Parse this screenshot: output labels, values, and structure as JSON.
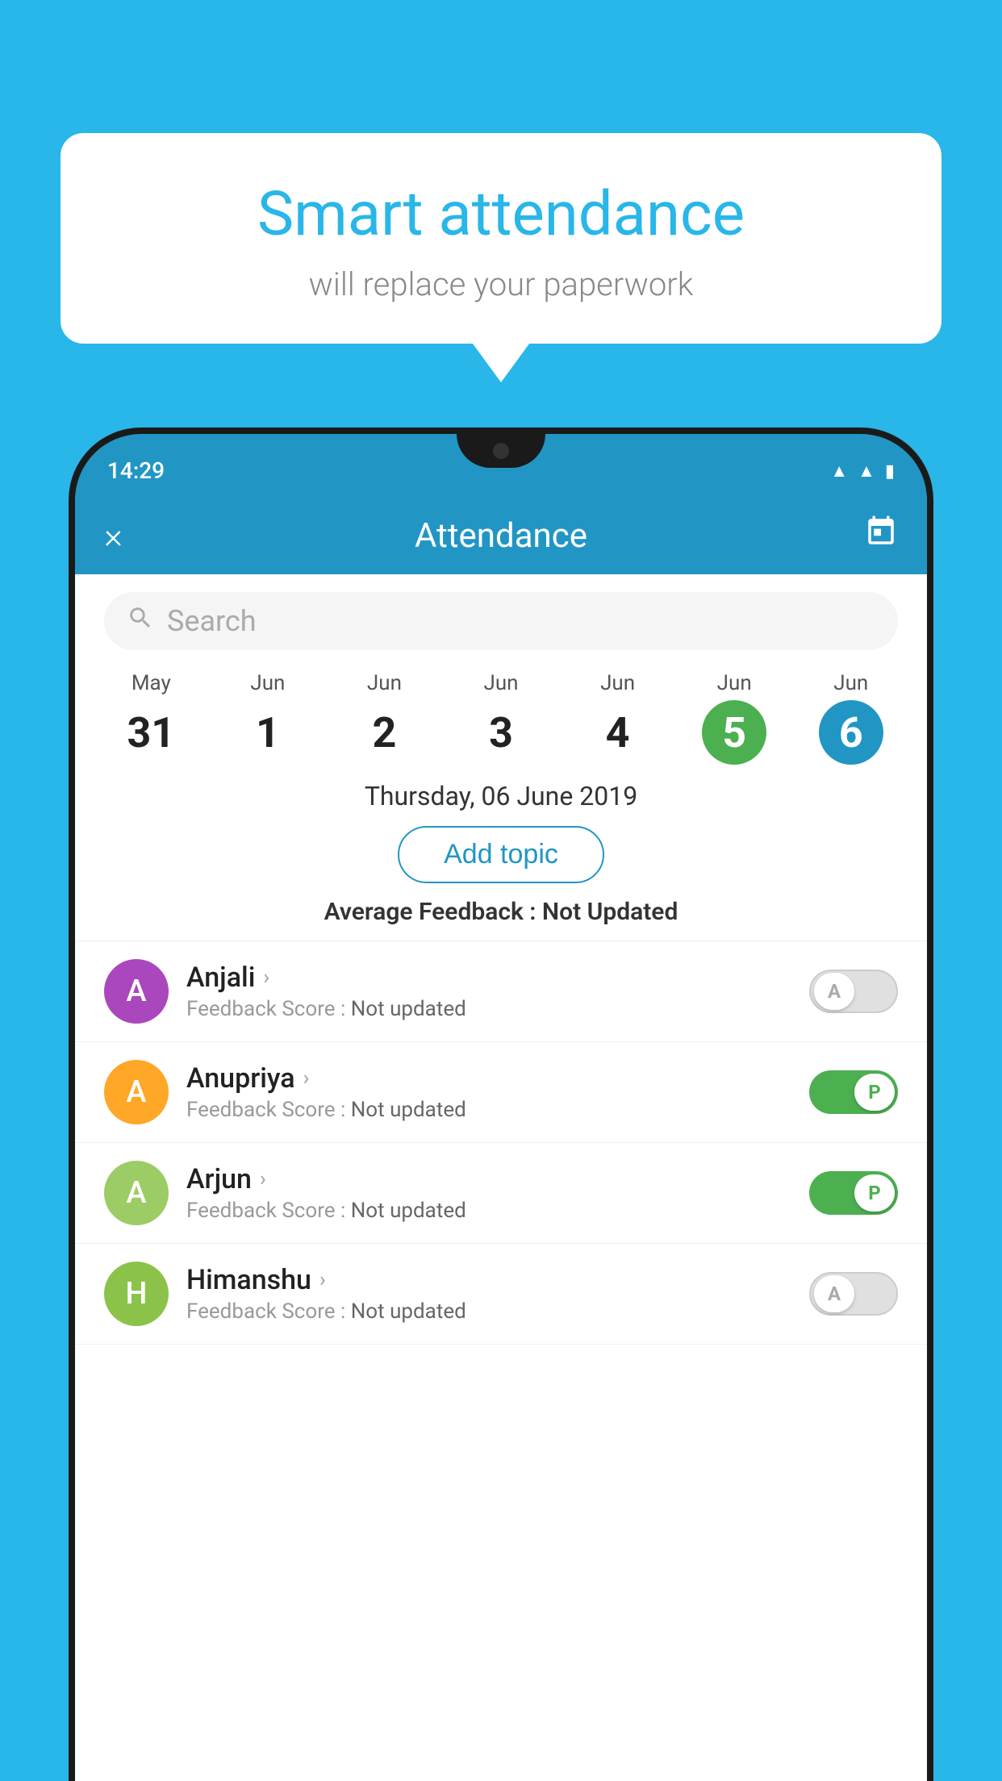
{
  "background_color": "#29b6e8",
  "speech_bubble": {
    "title": "Smart attendance",
    "subtitle": "will replace your paperwork"
  },
  "status_bar": {
    "time": "14:29",
    "icons": [
      "wifi",
      "signal",
      "battery"
    ]
  },
  "header": {
    "title": "Attendance",
    "close_label": "×",
    "calendar_label": "📅"
  },
  "search": {
    "placeholder": "Search"
  },
  "dates": [
    {
      "month": "May",
      "day": "31",
      "state": "normal"
    },
    {
      "month": "Jun",
      "day": "1",
      "state": "normal"
    },
    {
      "month": "Jun",
      "day": "2",
      "state": "normal"
    },
    {
      "month": "Jun",
      "day": "3",
      "state": "normal"
    },
    {
      "month": "Jun",
      "day": "4",
      "state": "normal"
    },
    {
      "month": "Jun",
      "day": "5",
      "state": "today"
    },
    {
      "month": "Jun",
      "day": "6",
      "state": "selected"
    }
  ],
  "selected_date_label": "Thursday, 06 June 2019",
  "add_topic_label": "Add topic",
  "average_feedback": {
    "label": "Average Feedback : ",
    "value": "Not Updated"
  },
  "students": [
    {
      "name": "Anjali",
      "avatar_letter": "A",
      "avatar_color": "#ab47bc",
      "feedback_label": "Feedback Score : ",
      "feedback_value": "Not updated",
      "toggle_state": "off",
      "toggle_label": "A"
    },
    {
      "name": "Anupriya",
      "avatar_letter": "A",
      "avatar_color": "#ffa726",
      "feedback_label": "Feedback Score : ",
      "feedback_value": "Not updated",
      "toggle_state": "on",
      "toggle_label": "P"
    },
    {
      "name": "Arjun",
      "avatar_letter": "A",
      "avatar_color": "#9ccc65",
      "feedback_label": "Feedback Score : ",
      "feedback_value": "Not updated",
      "toggle_state": "on",
      "toggle_label": "P"
    },
    {
      "name": "Himanshu",
      "avatar_letter": "H",
      "avatar_color": "#8bc34a",
      "feedback_label": "Feedback Score : ",
      "feedback_value": "Not updated",
      "toggle_state": "off",
      "toggle_label": "A"
    }
  ]
}
